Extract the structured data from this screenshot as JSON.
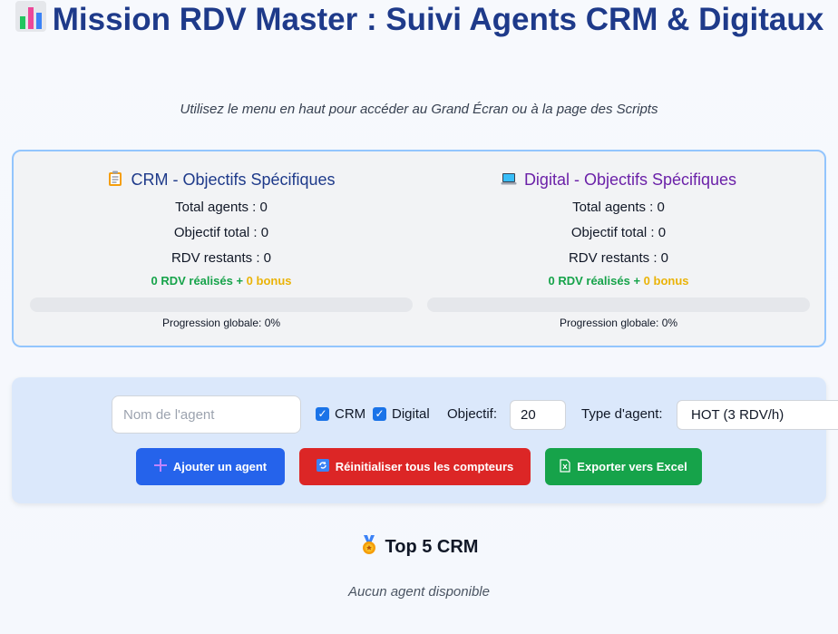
{
  "header": {
    "title": "Mission RDV Master : Suivi Agents CRM & Digitaux",
    "subtitle": "Utilisez le menu en haut pour accéder au Grand Écran ou à la page des Scripts"
  },
  "crm": {
    "heading": "CRM - Objectifs Spécifiques",
    "total_agents": "Total agents : 0",
    "objectif_total": "Objectif total : 0",
    "rdv_restants": "RDV restants : 0",
    "rdv_realises": "0 RDV réalisés",
    "plus": " + ",
    "bonus": "0 bonus",
    "progress_label": "Progression globale: 0%",
    "progress_pct": 0
  },
  "digital": {
    "heading": "Digital - Objectifs Spécifiques",
    "total_agents": "Total agents : 0",
    "objectif_total": "Objectif total : 0",
    "rdv_restants": "RDV restants : 0",
    "rdv_realises": "0 RDV réalisés",
    "plus": " + ",
    "bonus": "0 bonus",
    "progress_label": "Progression globale: 0%",
    "progress_pct": 0
  },
  "form": {
    "name_placeholder": "Nom de l'agent",
    "crm_label": "CRM",
    "crm_checked": true,
    "digital_label": "Digital",
    "digital_checked": true,
    "objectif_label": "Objectif:",
    "objectif_value": "20",
    "type_label": "Type d'agent:",
    "type_value": "HOT (3 RDV/h)",
    "add_label": "Ajouter un agent",
    "reset_label": "Réinitialiser tous les compteurs",
    "export_label": "Exporter vers Excel"
  },
  "top": {
    "title": "Top 5 CRM",
    "empty": "Aucun agent disponible"
  },
  "icons": {
    "title": "bar-chart-icon",
    "crm": "clipboard-icon",
    "digital": "laptop-icon",
    "add": "plus-icon",
    "reset": "refresh-icon",
    "export": "excel-file-icon",
    "top": "medal-icon"
  },
  "colors": {
    "title": "#1e3a8a",
    "digital": "#6b21a8",
    "done_green": "#16a34a",
    "bonus_yellow": "#eab308",
    "btn_add": "#2563eb",
    "btn_reset": "#dc2626",
    "btn_export": "#16a34a"
  }
}
